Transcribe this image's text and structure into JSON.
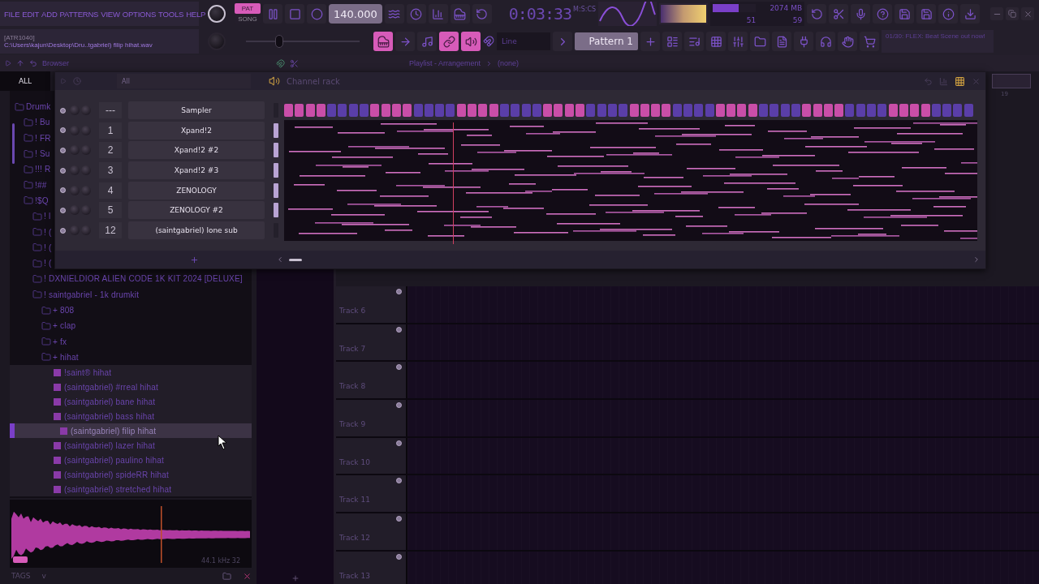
{
  "menu": [
    "FILE",
    "EDIT",
    "ADD",
    "PATTERNS",
    "VIEW",
    "OPTIONS",
    "TOOLS",
    "HELP"
  ],
  "transport": {
    "modes": [
      {
        "label": "PAT",
        "selected": true
      },
      {
        "label": "SONG",
        "selected": false
      }
    ],
    "tempo": "140.000",
    "time": "0:03:33",
    "time_unit": "M:S:CS"
  },
  "cpu": {
    "value": "51",
    "level": 0.6,
    "memory": "2074 MB",
    "polyphony": "59"
  },
  "hint": {
    "title": "[ATR1040]",
    "text": "C:\\Users\\kajun\\Desktop\\Dru..tgabriel) filip hihat.wav"
  },
  "pitch_slider": {
    "level": 0.29
  },
  "snap": "Line",
  "pattern": "Pattern 1",
  "news": "01/30: FLEX: Beat Scene out now!",
  "browser": {
    "title": "Browser",
    "tab": "ALL",
    "tree": [
      {
        "label": "Drumk",
        "kind": "folder",
        "children": [
          {
            "label": "! Bu",
            "kind": "folder"
          },
          {
            "label": "! FR",
            "kind": "folder"
          },
          {
            "label": "! Su",
            "kind": "folder"
          },
          {
            "label": "!!! R",
            "kind": "folder"
          },
          {
            "label": "!##",
            "kind": "folder"
          },
          {
            "label": "!$Q",
            "kind": "folder",
            "children": [
              {
                "label": "! l",
                "kind": "folder"
              },
              {
                "label": "! (",
                "kind": "folder"
              },
              {
                "label": "! (",
                "kind": "folder"
              },
              {
                "label": "! (",
                "kind": "folder"
              },
              {
                "label": "! DXNIELDIOR ALIEN CODE 1K KIT 2024 [DELUXE]",
                "kind": "folder"
              },
              {
                "label": "! saintgabriel - 1k drumkit",
                "kind": "folder",
                "children": [
                  {
                    "label": "+ 808",
                    "kind": "folder"
                  },
                  {
                    "label": "+ clap",
                    "kind": "folder"
                  },
                  {
                    "label": "+ fx",
                    "kind": "folder"
                  },
                  {
                    "label": "+ hihat",
                    "kind": "folder",
                    "children": [
                      {
                        "label": "!saint® hihat",
                        "kind": "file",
                        "selected": false
                      },
                      {
                        "label": "(saintgabriel) #rreal hihat",
                        "kind": "file",
                        "selected": false
                      },
                      {
                        "label": "(saintgabriel) bane hihat",
                        "kind": "file",
                        "selected": false
                      },
                      {
                        "label": "(saintgabriel) bass hihat",
                        "kind": "file",
                        "selected": false
                      },
                      {
                        "label": "(saintgabriel) filip hihat",
                        "kind": "file",
                        "selected": true
                      },
                      {
                        "label": "(saintgabriel) lazer hihat",
                        "kind": "file",
                        "selected": false
                      },
                      {
                        "label": "(saintgabriel) paulino hihat",
                        "kind": "file",
                        "selected": false
                      },
                      {
                        "label": "(saintgabriel) spideRR hihat",
                        "kind": "file",
                        "selected": false
                      },
                      {
                        "label": "(saintgabriel) stretched hihat",
                        "kind": "file",
                        "selected": false
                      }
                    ]
                  }
                ]
              }
            ]
          }
        ]
      }
    ],
    "sample_info": "44.1 kHz 32",
    "tags_label": "TAGS",
    "tags_value": "v"
  },
  "playlist": {
    "title": "Playlist - Arrangement",
    "crumb": "(none)",
    "bar": "19",
    "tracks": [
      "Track 6",
      "Track 7",
      "Track 8",
      "Track 9",
      "Track 10",
      "Track 11",
      "Track 12",
      "Track 13"
    ]
  },
  "channel_rack": {
    "title": "Channel rack",
    "filter": "All",
    "channels": [
      {
        "number": "---",
        "name": "Sampler",
        "selected": false,
        "kind": "steps"
      },
      {
        "number": "1",
        "name": "Xpand!2",
        "selected": true,
        "kind": "notes"
      },
      {
        "number": "2",
        "name": "Xpand!2 #2",
        "selected": true,
        "kind": "notes"
      },
      {
        "number": "3",
        "name": "Xpand!2 #3",
        "selected": true,
        "kind": "notes"
      },
      {
        "number": "4",
        "name": "ZENOLOGY",
        "selected": true,
        "kind": "notes"
      },
      {
        "number": "5",
        "name": "ZENOLOGY #2",
        "selected": true,
        "kind": "notes"
      },
      {
        "number": "12",
        "name": "(saintgabriel) lone sub",
        "selected": false,
        "kind": "notes"
      }
    ]
  }
}
